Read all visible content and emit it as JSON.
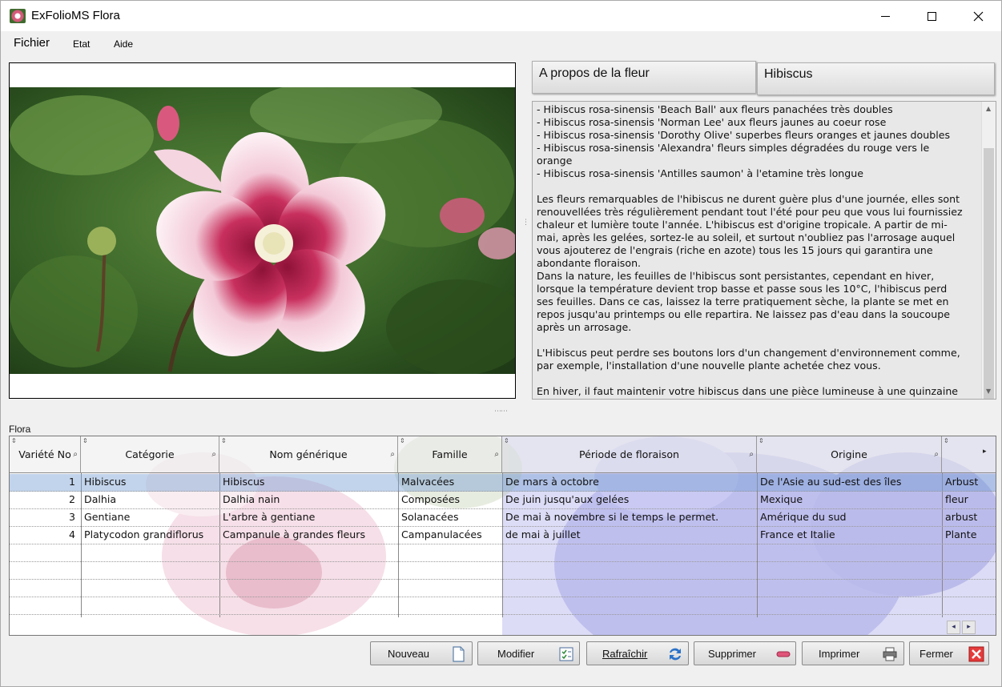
{
  "window": {
    "title": "ExFolioMS Flora"
  },
  "menu": {
    "fichier": "Fichier",
    "etat": "Etat",
    "aide": "Aide"
  },
  "tabs": {
    "about": "A propos de la fleur",
    "flower_name": "Hibiscus"
  },
  "description": "- Hibiscus rosa-sinensis 'Beach Ball' aux fleurs panachées très doubles\n- Hibiscus rosa-sinensis 'Norman Lee' aux fleurs jaunes au coeur rose\n- Hibiscus rosa-sinensis 'Dorothy Olive' superbes fleurs oranges et jaunes doubles\n- Hibiscus rosa-sinensis 'Alexandra' fleurs simples dégradées du rouge vers le\norange\n- Hibiscus rosa-sinensis 'Antilles saumon' à l'etamine très longue\n\nLes fleurs remarquables de l'hibiscus ne durent guère plus d'une journée, elles sont\nrenouvellées très régulièrement pendant tout l'été pour peu que vous lui fournissiez\nchaleur et lumière toute l'année. L'hibiscus est d'origine tropicale. A partir de mi-\nmai, après les gelées, sortez-le au soleil, et surtout n'oubliez pas l'arrosage auquel\nvous ajouterez de l'engrais (riche en azote) tous les 15 jours qui garantira une\nabondante floraison.\nDans la nature, les feuilles de l'hibiscus sont persistantes, cependant en hiver,\nlorsque la température devient trop basse et passe sous les 10°C, l'hibiscus perd\nses feuilles. Dans ce cas, laissez la terre pratiquement sèche, la plante se met en\nrepos jusqu'au printemps ou elle repartira. Ne laissez pas d'eau dans la soucoupe\naprès un arrosage.\n\nL'Hibiscus peut perdre ses boutons lors d'un changement d'environnement comme,\npar exemple, l'installation d'une nouvelle plante achetée chez vous.\n\nEn hiver, il faut maintenir votre hibiscus dans une pièce lumineuse à une quinzaine",
  "grid": {
    "label": "Flora",
    "columns": [
      "Variété No",
      "Catégorie",
      "Nom générique",
      "Famille",
      "Période de floraison",
      "Origine",
      ""
    ],
    "rows": [
      [
        "1",
        "Hibiscus",
        "Hibiscus",
        "Malvacées",
        "De mars à octobre",
        "De l'Asie au sud-est des îles",
        "Arbust"
      ],
      [
        "2",
        "Dalhia",
        "Dalhia nain",
        "Composées",
        "De juin jusqu'aux gelées",
        "Mexique",
        "fleur"
      ],
      [
        "3",
        "Gentiane",
        "L'arbre à gentiane",
        "Solanacées",
        "De mai à novembre si le temps le permet.",
        "Amérique du sud",
        "arbust"
      ],
      [
        "4",
        "Platycodon grandiflorus",
        "Campanule à grandes fleurs",
        "Campanulacées",
        "de mai à juillet",
        "France et Italie",
        "Plante"
      ]
    ]
  },
  "buttons": {
    "nouveau": "Nouveau",
    "modifier": "Modifier",
    "rafraichir": "Rafraîchir",
    "supprimer": "Supprimer",
    "imprimer": "Imprimer",
    "fermer": "Fermer"
  },
  "colors": {
    "selection": "#9ab8dc",
    "flower_pink": "#d4547a",
    "leaf_green": "#3d6b2c"
  }
}
